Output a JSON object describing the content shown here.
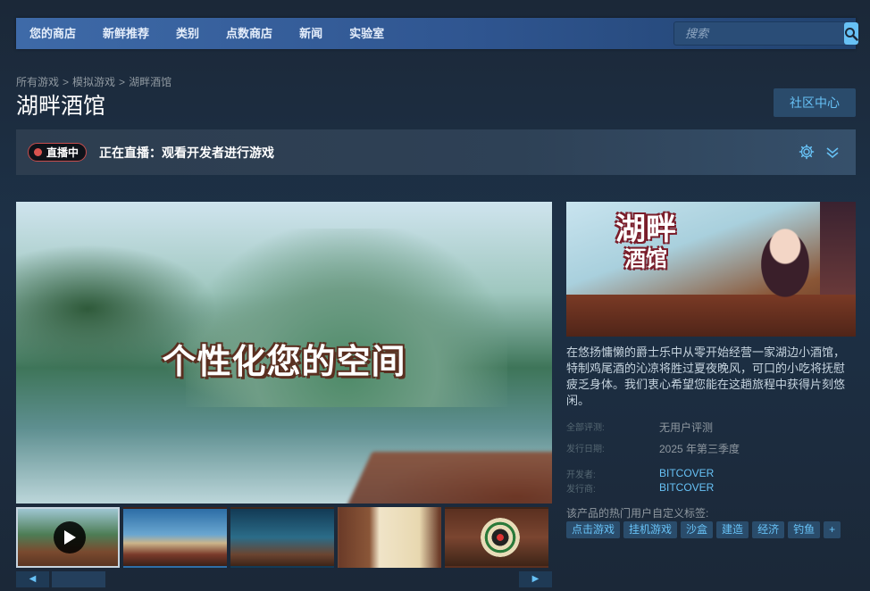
{
  "nav": {
    "items": [
      "您的商店",
      "新鲜推荐",
      "类别",
      "点数商店",
      "新闻",
      "实验室"
    ],
    "search_placeholder": "搜索"
  },
  "breadcrumb": [
    "所有游戏",
    "模拟游戏",
    "湖畔酒馆"
  ],
  "title": "湖畔酒馆",
  "community_button": "社区中心",
  "live": {
    "badge": "直播中",
    "text": "正在直播：观看开发者进行游戏"
  },
  "media": {
    "caption": "个性化您的空间",
    "thumbnails": [
      "video",
      "screenshot",
      "screenshot",
      "screenshot",
      "screenshot"
    ]
  },
  "capsule": {
    "logo_line1": "湖畔",
    "logo_line2": "酒馆"
  },
  "description": "在悠扬慵懒的爵士乐中从零开始经营一家湖边小酒馆，特制鸡尾酒的沁凉将胜过夏夜晚风，可口的小吃将抚慰疲乏身体。我们衷心希望您能在这趟旅程中获得片刻悠闲。",
  "meta": {
    "reviews_label": "全部评测:",
    "reviews_value": "无用户评测",
    "release_label": "发行日期:",
    "release_value": "2025 年第三季度",
    "developer_label": "开发者:",
    "developer_value": "BITCOVER",
    "publisher_label": "发行商:",
    "publisher_value": "BITCOVER"
  },
  "tags": {
    "title": "该产品的热门用户自定义标签:",
    "items": [
      "点击游戏",
      "挂机游戏",
      "沙盒",
      "建造",
      "经济",
      "钓鱼"
    ],
    "more": "+"
  },
  "colors": {
    "accent": "#67c1f5",
    "background": "#1b2838",
    "live_red": "#d9534f"
  }
}
